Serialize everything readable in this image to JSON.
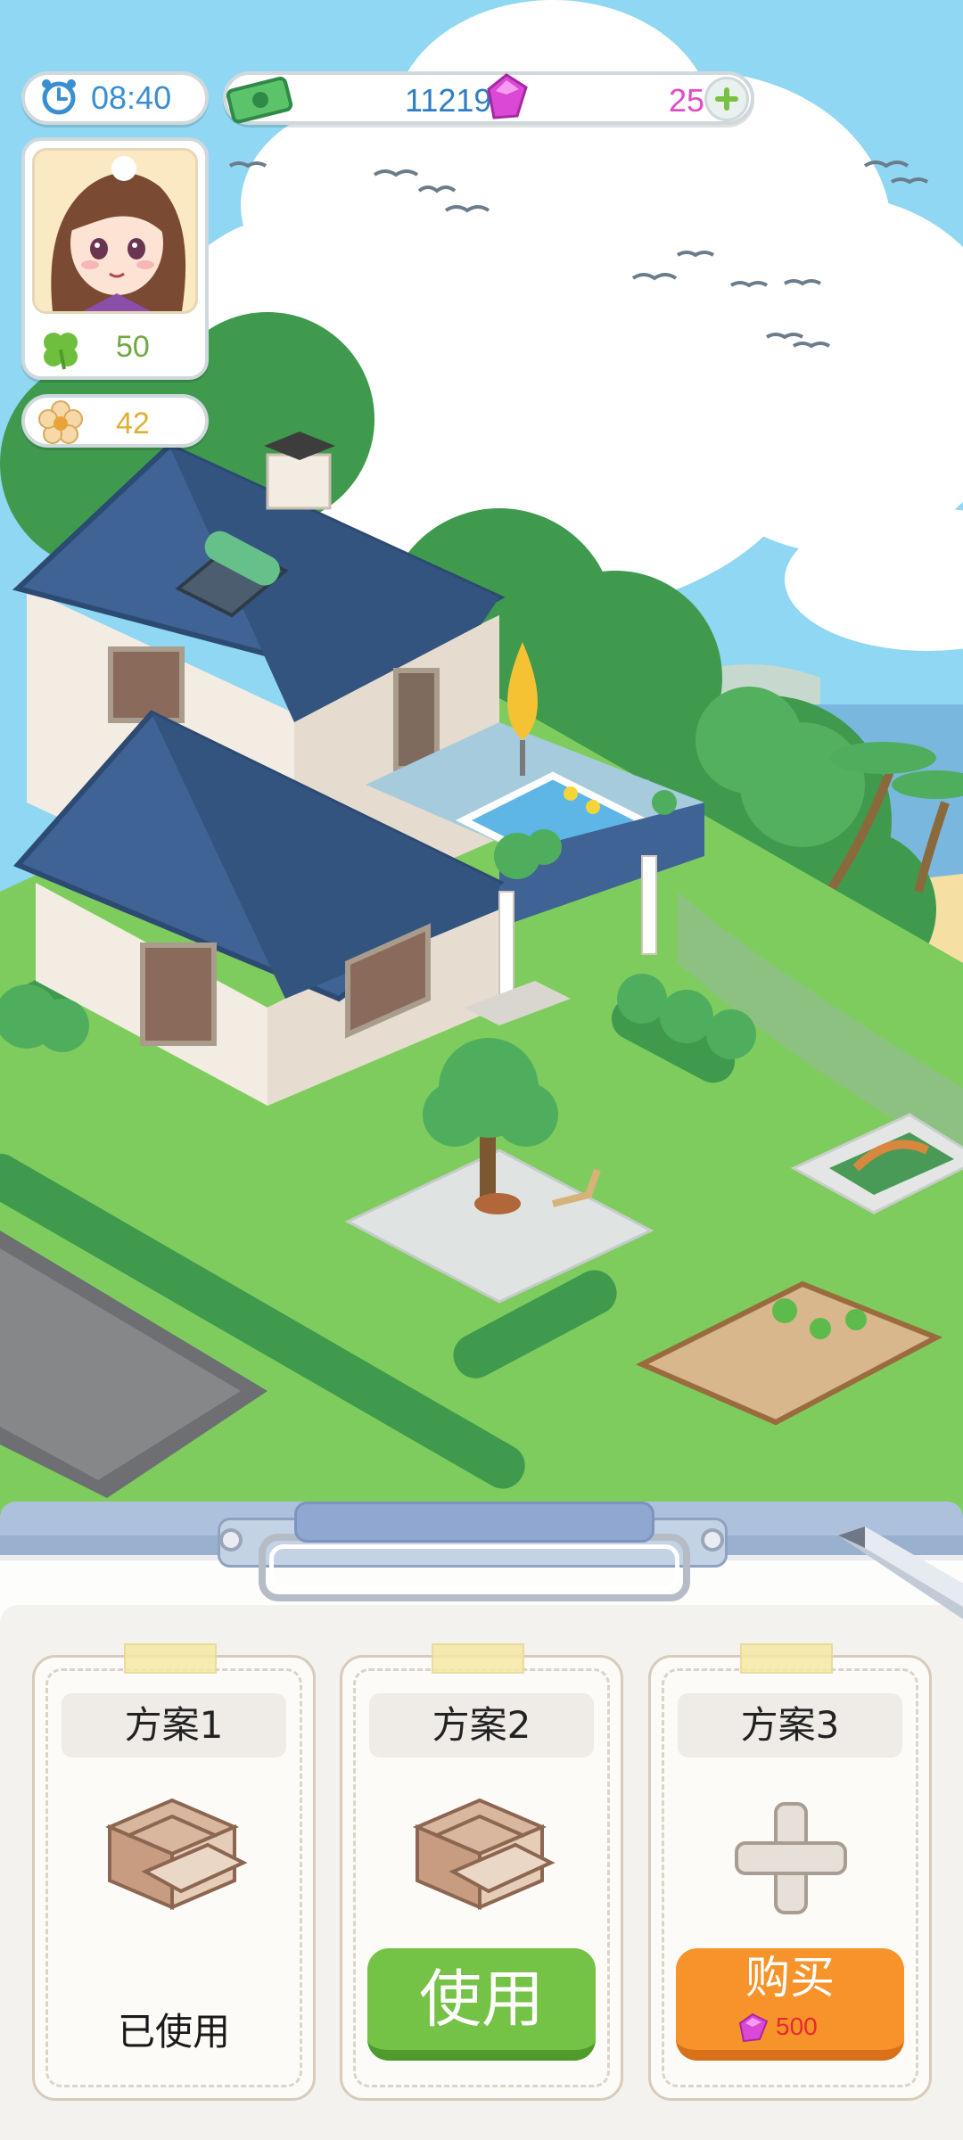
{
  "hud": {
    "clock": {
      "icon": "alarm-clock-icon",
      "time": "08:40"
    },
    "resources": {
      "money_icon": "cash-icon",
      "money": "11219",
      "gem_icon": "gem-icon",
      "gems": "25",
      "add_icon": "plus-icon"
    },
    "profile": {
      "avatar": "character-portrait",
      "clover_icon": "clover-icon",
      "clover_count": "50"
    },
    "flowers": {
      "icon": "flower-icon",
      "count": "42"
    }
  },
  "panel": {
    "slots": [
      {
        "title": "方案1",
        "icon": "room-layout-icon",
        "status": "已使用"
      },
      {
        "title": "方案2",
        "icon": "room-layout-icon",
        "button": "使用"
      },
      {
        "title": "方案3",
        "icon": "plus-icon",
        "button": "购买",
        "price": "500",
        "price_icon": "gem-icon"
      }
    ],
    "pencil_icon": "pencil-icon"
  },
  "colors": {
    "sky": "#8fd7f2",
    "roof": "#3f6394",
    "grass": "#7fcc5e",
    "use_button": "#74c246",
    "buy_button": "#f6932a",
    "gem": "#e04cc7"
  }
}
